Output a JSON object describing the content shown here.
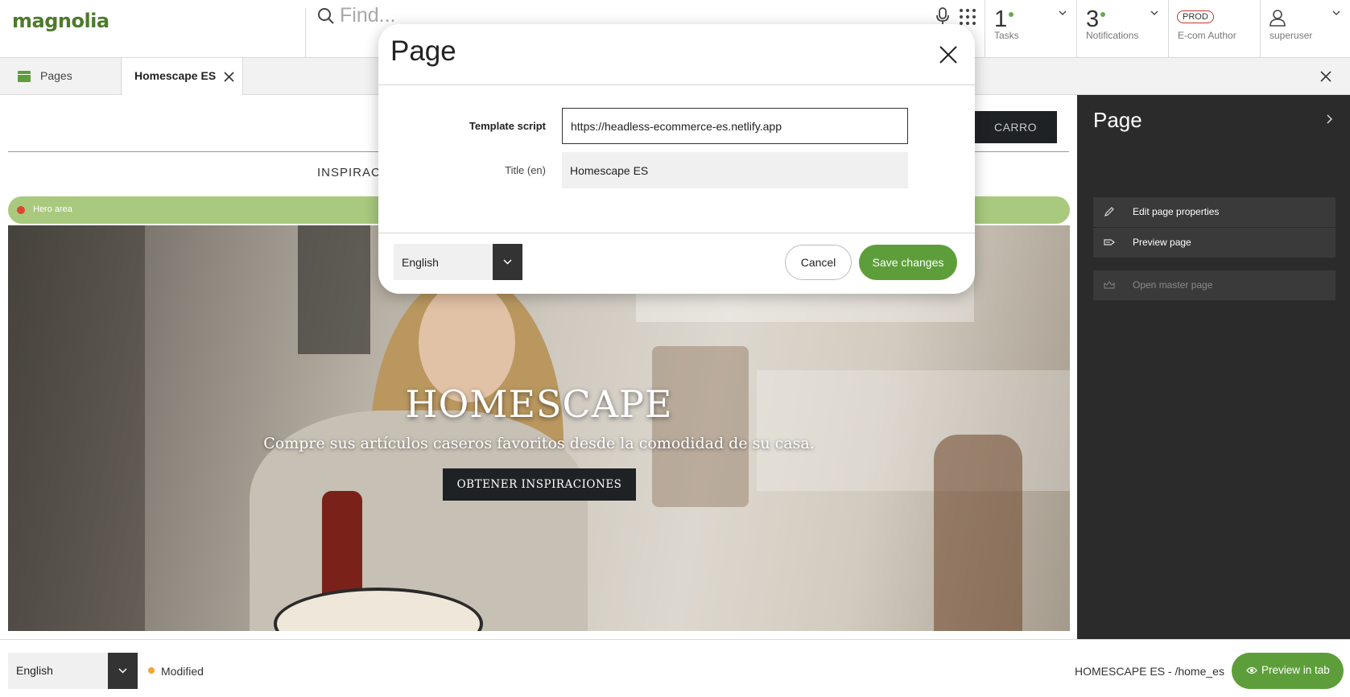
{
  "app": {
    "logo_text": "magnolia",
    "search": {
      "placeholder": "Find..."
    }
  },
  "header": {
    "tasks": {
      "count": "1",
      "label": "Tasks"
    },
    "notifications": {
      "count": "3",
      "label": "Notifications"
    },
    "environment": {
      "badge": "PROD",
      "label": "E-com Author"
    },
    "user": {
      "label": "superuser"
    },
    "colors": {
      "status_dot": "#6aa84f",
      "prod_border": "#c0392b"
    }
  },
  "tabs": [
    {
      "label": "Pages",
      "icon": "pages-icon"
    },
    {
      "label": "Homescape ES",
      "active": true
    }
  ],
  "preview": {
    "cart_button": "CARRO",
    "nav_text": "INSPIRACIÓ",
    "area_label": "Hero area",
    "hero_title": "HOMESCAPE",
    "hero_subtitle": "Compre sus artículos caseros favoritos desde la comodidad de su casa.",
    "hero_cta": "OBTENER INSPIRACIONES"
  },
  "side_panel": {
    "title": "Page",
    "actions": [
      {
        "label": "Edit page properties",
        "icon": "pencil-icon",
        "enabled": true
      },
      {
        "label": "Preview page",
        "icon": "preview-icon",
        "enabled": true
      },
      {
        "label": "Open master page",
        "icon": "master-page-icon",
        "enabled": false
      }
    ]
  },
  "bottom_bar": {
    "language": "English",
    "status": "Modified",
    "status_color": "#f2a533",
    "path": "HOMESCAPE ES - /home_es",
    "preview_button": "Preview in tab"
  },
  "dialog": {
    "title": "Page",
    "fields": [
      {
        "label": "Template script",
        "value": "https://headless-ecommerce-es.netlify.app"
      },
      {
        "label": "Title (en)",
        "value": "Homescape ES"
      }
    ],
    "language": "English",
    "cancel": "Cancel",
    "save": "Save changes",
    "accent": "#5e9e3a"
  }
}
